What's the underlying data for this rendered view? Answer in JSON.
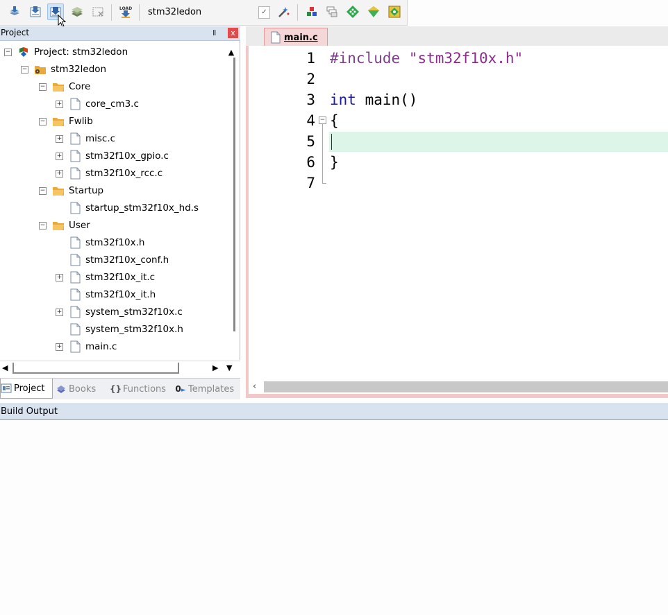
{
  "toolbar": {
    "target_name": "stm32ledon",
    "load_label": "LOAD"
  },
  "project_panel": {
    "title": "Project",
    "pin_glyph": "Ⅱ",
    "close_glyph": "x"
  },
  "tree": {
    "root": "Project: stm32ledon",
    "target": "stm32ledon",
    "groups": [
      {
        "name": "Core",
        "files": [
          "core_cm3.c"
        ]
      },
      {
        "name": "Fwlib",
        "files": [
          "misc.c",
          "stm32f10x_gpio.c",
          "stm32f10x_rcc.c"
        ]
      },
      {
        "name": "Startup",
        "files": [
          "startup_stm32f10x_hd.s"
        ]
      },
      {
        "name": "User",
        "files": [
          "stm32f10x.h",
          "stm32f10x_conf.h",
          "stm32f10x_it.c",
          "stm32f10x_it.h",
          "system_stm32f10x.c",
          "system_stm32f10x.h",
          "main.c"
        ]
      }
    ]
  },
  "bottom_tabs": [
    {
      "label": "Project",
      "icon": "project-icon",
      "active": true
    },
    {
      "label": "Books",
      "icon": "books-icon",
      "active": false
    },
    {
      "label": "Functions",
      "icon": "functions-icon",
      "active": false
    },
    {
      "label": "Templates",
      "icon": "templates-icon",
      "active": false
    }
  ],
  "editor": {
    "tab_label": "main.c",
    "line_numbers": [
      "1",
      "2",
      "3",
      "4",
      "5",
      "6",
      "7"
    ],
    "lines": {
      "l1_directive": "#include",
      "l1_string": "\"stm32f10x.h\"",
      "l3_keyword": "int",
      "l3_rest": " main()",
      "l4": "{",
      "l6": "}"
    },
    "current_line": 5,
    "colors": {
      "directive": "#7b3f8c",
      "keyword": "#1a1aa6",
      "string": "#8b2b8b",
      "highlight": "#ddf4e8"
    }
  },
  "build_output": {
    "title": "Build Output"
  }
}
